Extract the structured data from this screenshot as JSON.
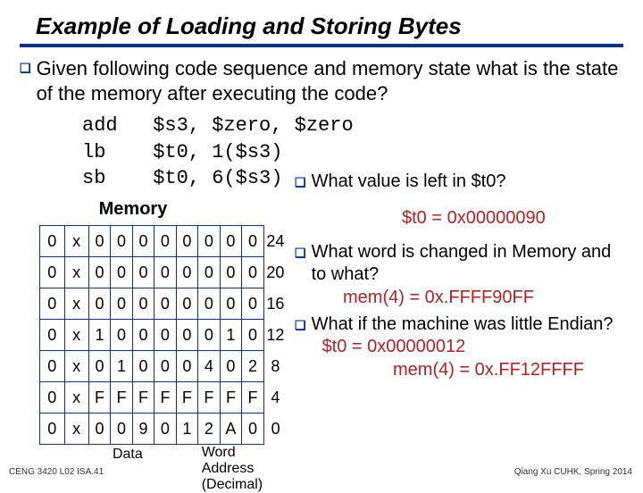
{
  "title": "Example of Loading and Storing Bytes",
  "intro": "Given following code sequence and memory state what is the state of the memory after executing the code?",
  "code": "add   $s3, $zero, $zero\nlb    $t0, 1($s3)\nsb    $t0, 6($s3)",
  "memory_heading": "Memory",
  "mem_rows": [
    {
      "cells": [
        "0",
        "x",
        "0",
        "0",
        "0",
        "0",
        "0",
        "0",
        "0",
        "0"
      ],
      "addr": "24"
    },
    {
      "cells": [
        "0",
        "x",
        "0",
        "0",
        "0",
        "0",
        "0",
        "0",
        "0",
        "0"
      ],
      "addr": "20"
    },
    {
      "cells": [
        "0",
        "x",
        "0",
        "0",
        "0",
        "0",
        "0",
        "0",
        "0",
        "0"
      ],
      "addr": "16"
    },
    {
      "cells": [
        "0",
        "x",
        "1",
        "0",
        "0",
        "0",
        "0",
        "0",
        "1",
        "0"
      ],
      "addr": "12"
    },
    {
      "cells": [
        "0",
        "x",
        "0",
        "1",
        "0",
        "0",
        "0",
        "4",
        "0",
        "2"
      ],
      "addr": "8"
    },
    {
      "cells": [
        "0",
        "x",
        "F",
        "F",
        "F",
        "F",
        "F",
        "F",
        "F",
        "F"
      ],
      "addr": "4"
    },
    {
      "cells": [
        "0",
        "x",
        "0",
        "0",
        "9",
        "0",
        "1",
        "2",
        "A",
        "0"
      ],
      "addr": "0"
    }
  ],
  "data_label": "Data",
  "word_label": "Word\nAddress (Decimal)",
  "q1": "What value is left in $t0?",
  "a1": "$t0 = 0x00000090",
  "q2": "What word is changed in Memory and to what?",
  "a2": "mem(4) = 0x.FFFF90FF",
  "q3": "What if the machine was little Endian?",
  "a3a": "$t0 = 0x00000012",
  "a3b": "mem(4) = 0x.FF12FFFF",
  "footer_left": "CENG 3420 L02 ISA.41",
  "footer_right": "Qiang Xu   CUHK, Spring 2014"
}
